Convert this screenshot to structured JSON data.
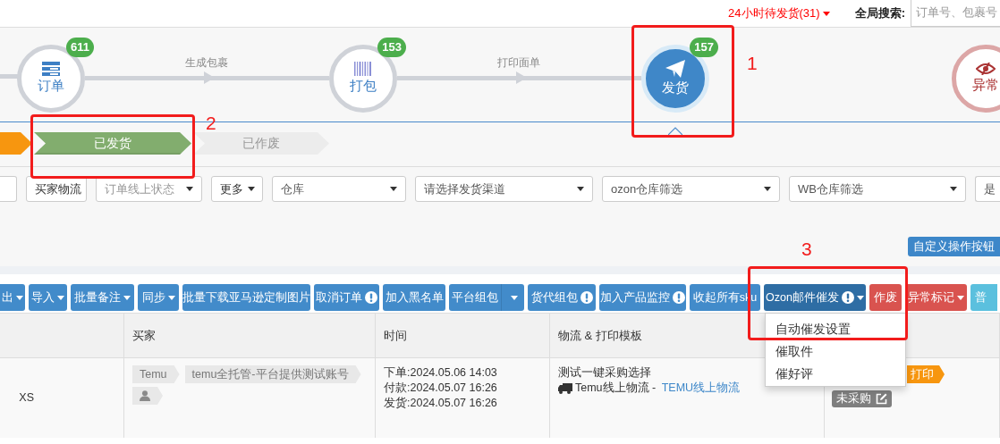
{
  "top_bar": {
    "pending_link": "24小时待发货(31)",
    "search_label": "全局搜索:",
    "search_placeholder": "订单号、包裹号"
  },
  "flow": {
    "steps": [
      {
        "label": "订单",
        "count": "611",
        "kind": "normal",
        "selected": false
      },
      {
        "label": "打包",
        "count": "153",
        "kind": "normal",
        "selected": false
      },
      {
        "label": "发货",
        "count": "157",
        "kind": "normal",
        "selected": true
      },
      {
        "label": "异常",
        "kind": "alert",
        "selected": false
      }
    ],
    "links": [
      "生成包裹",
      "打印面单"
    ]
  },
  "status_tabs": [
    {
      "color": "#f7960f",
      "selected": false
    },
    {
      "label": "已发货",
      "color": "#82ad6e",
      "selected": true
    },
    {
      "label": "已作废",
      "color": "#ececec",
      "selected": false
    }
  ],
  "filters": [
    {
      "kind": "button"
    },
    {
      "kind": "button",
      "label": "买家物流"
    },
    {
      "kind": "select",
      "placeholder": "订单线上状态"
    },
    {
      "kind": "menu",
      "label": "更多"
    },
    {
      "kind": "select",
      "value": "仓库"
    },
    {
      "kind": "select",
      "value": "请选择发货渠道"
    },
    {
      "kind": "select",
      "value": "ozon仓库筛选"
    },
    {
      "kind": "select",
      "value": "WB仓库筛选"
    },
    {
      "kind": "select",
      "value": "是"
    }
  ],
  "custom_button": "自定义操作按钮",
  "toolbar": [
    {
      "label": "出",
      "kind": "primary",
      "caret": true,
      "alert": false,
      "expanded": false
    },
    {
      "label": "导入",
      "kind": "primary",
      "caret": true,
      "alert": false,
      "expanded": false
    },
    {
      "label": "批量备注",
      "kind": "primary",
      "caret": true,
      "alert": false,
      "expanded": false
    },
    {
      "label": "同步",
      "kind": "primary",
      "caret": true,
      "alert": false,
      "expanded": false
    },
    {
      "label": "批量下载亚马逊定制图片",
      "kind": "primary",
      "caret": false,
      "alert": false,
      "expanded": false
    },
    {
      "label": "取消订单",
      "kind": "primary",
      "caret": false,
      "alert": true,
      "expanded": false
    },
    {
      "label": "加入黑名单",
      "kind": "primary",
      "caret": false,
      "alert": false,
      "expanded": false
    },
    {
      "label": "平台组包",
      "kind": "split",
      "caret": true,
      "alert": false,
      "expanded": false
    },
    {
      "label": "货代组包",
      "kind": "primary",
      "caret": false,
      "alert": true,
      "expanded": false
    },
    {
      "label": "加入产品监控",
      "kind": "primary",
      "caret": false,
      "alert": true,
      "expanded": false
    },
    {
      "label": "收起所有sku",
      "kind": "primary",
      "caret": false,
      "alert": false,
      "expanded": false
    },
    {
      "label": "Ozon邮件催发",
      "kind": "primary",
      "caret": true,
      "alert": true,
      "expanded": true
    },
    {
      "label": "作废",
      "kind": "danger",
      "caret": false,
      "alert": false,
      "expanded": false
    },
    {
      "label": "异常标记",
      "kind": "danger",
      "caret": true,
      "alert": false,
      "expanded": false
    },
    {
      "label": "普",
      "kind": "info",
      "caret": false,
      "alert": false,
      "expanded": false
    }
  ],
  "dropdown_menu": [
    "自动催发设置",
    "催取件",
    "催好评"
  ],
  "table": {
    "columns": [
      "买家",
      "时间",
      "物流 & 打印模板"
    ],
    "rows": [
      {
        "product": "XS",
        "platform_tag": "Temu",
        "shop_tag": "temu全托管-平台提供测试账号",
        "times": [
          "下单:2024.05.06 14:03",
          "付款:2024.05.07 16:26",
          "发货:2024.05.07 16:26"
        ],
        "logistics_note": "测试一键采购选择",
        "logistics_carrier": "Temu线上物流 - ",
        "logistics_link": "TEMU线上物流",
        "print_tag": "打印",
        "purchase_badge": "未采购"
      }
    ]
  },
  "annotations": [
    "1",
    "2",
    "3"
  ]
}
